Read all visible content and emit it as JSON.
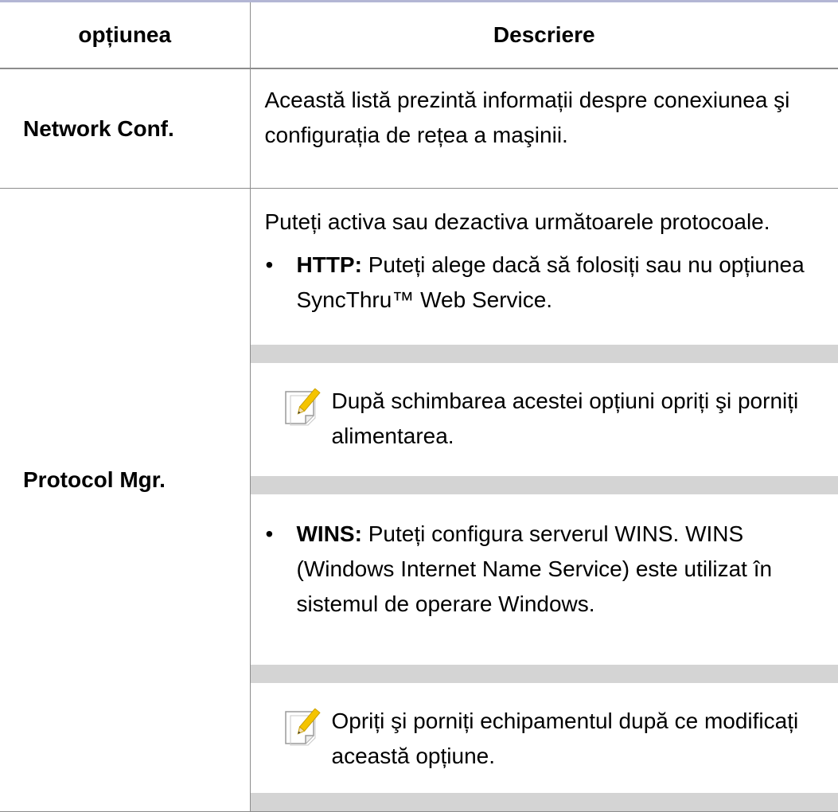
{
  "header": {
    "col_option": "opțiunea",
    "col_description": "Descriere"
  },
  "rows": [
    {
      "option": "Network Conf.",
      "description": "Această listă prezintă informații despre conexiunea şi configurația de rețea a maşinii."
    },
    {
      "option": "Protocol Mgr.",
      "intro": "Puteți activa sau dezactiva următoarele protocoale.",
      "items": [
        {
          "bullet": "•",
          "term": "HTTP:",
          "text": " Puteți alege dacă să folosiți sau nu opțiunea SyncThru™ Web Service.",
          "note": "După schimbarea acestei opțiuni opriți şi porniți alimentarea."
        },
        {
          "bullet": "•",
          "term": "WINS:",
          "text": " Puteți configura serverul WINS. WINS (Windows Internet Name Service) este utilizat în sistemul de operare Windows.",
          "note": "Opriți şi porniți echipamentul după ce modificați această opțiune."
        }
      ]
    }
  ],
  "icons": {
    "note": "note-pencil-icon"
  },
  "colors": {
    "rule": "#8c8c8c",
    "top_rule": "#b3b6d4",
    "note_bar": "#d4d4d4",
    "pencil": "#f5c400"
  }
}
